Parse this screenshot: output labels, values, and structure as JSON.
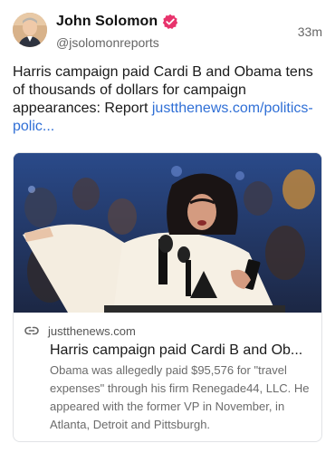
{
  "author": {
    "display_name": "John Solomon",
    "handle": "@jsolomonreports",
    "verified_icon": "verified-badge-icon",
    "accent_color": "#e8336c"
  },
  "timestamp": "33m",
  "post": {
    "text": "Harris campaign paid Cardi B and Obama tens of thousands of dollars for campaign appearances: Report ",
    "link_text": "justthenews.com/politics-polic...",
    "link_color": "#2f6fd6"
  },
  "card": {
    "domain": "justthenews.com",
    "title": "Harris campaign paid Cardi B and Ob...",
    "description": "Obama was allegedly paid $95,576 for \"travel expenses\" through his firm Renegade44, LLC. He appeared with the former VP in November, in Atlanta, Detroit and Pittsburgh.",
    "link_icon": "link-icon"
  }
}
